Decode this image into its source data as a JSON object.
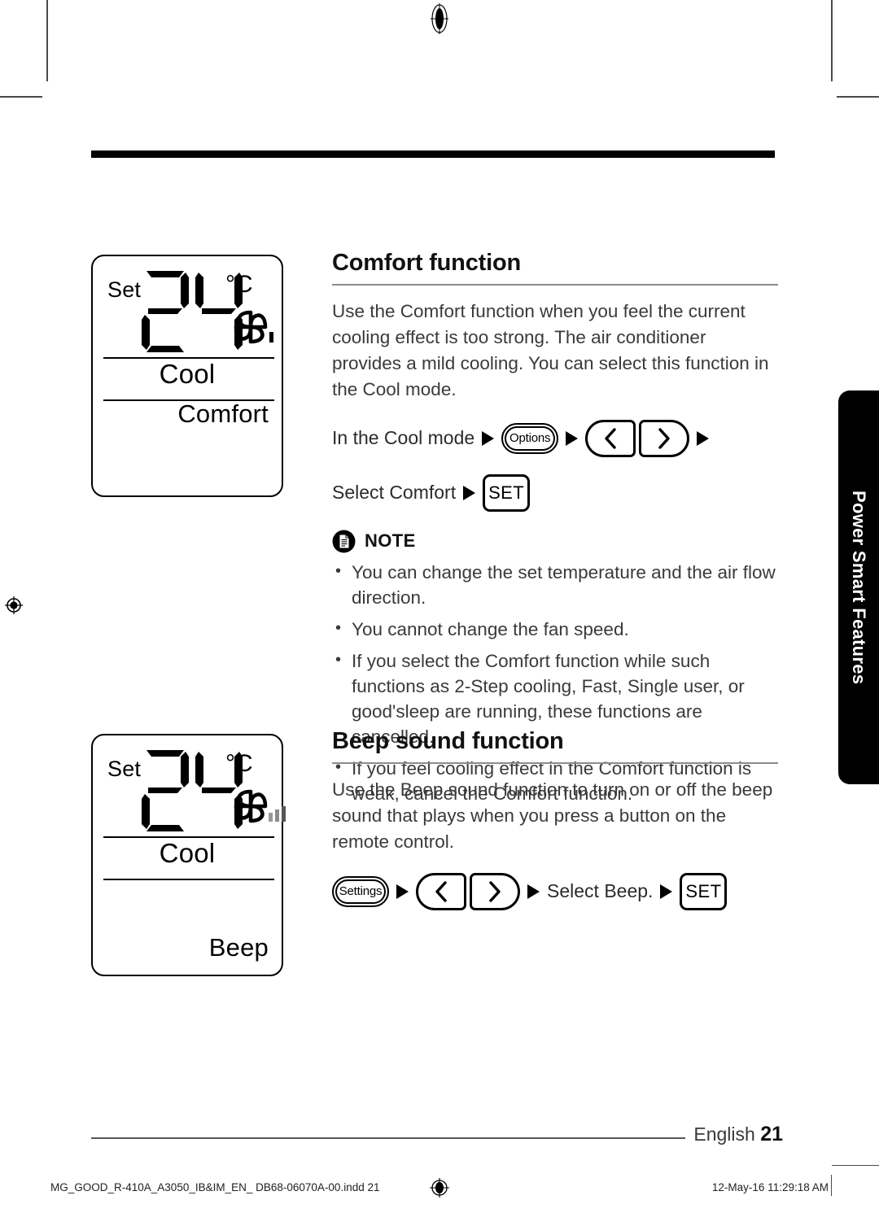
{
  "page": {
    "language_label": "English",
    "page_number": "21",
    "side_tab_label": "Power Smart Features"
  },
  "displays": [
    {
      "set_label": "Set",
      "temperature": "24",
      "unit": "°C",
      "fan_icon": "fan-pinwheel-icon",
      "fan_level": 1,
      "mode": "Cool",
      "feature": "Comfort"
    },
    {
      "set_label": "Set",
      "temperature": "24",
      "unit": "°C",
      "fan_icon": "fan-pinwheel-icon",
      "fan_level": 3,
      "mode": "Cool",
      "feature": "Beep"
    }
  ],
  "sections": [
    {
      "title": "Comfort function",
      "body": "Use the Comfort function when you feel the current cooling effect is too strong. The air conditioner provides a mild cooling. You can select this function in the Cool mode.",
      "steps_line1": {
        "lead_text": "In the Cool mode",
        "options_button": "Options",
        "left_button_icon": "chevron-left-icon",
        "right_button_icon": "chevron-right-icon"
      },
      "steps_line2": {
        "lead_text": "Select Comfort",
        "set_button": "SET"
      }
    },
    {
      "title": "Beep sound function",
      "body": "Use the Beep sound function to turn on or off the beep sound that plays when you press a button on the remote control.",
      "steps_line1": {
        "settings_button": "Settings",
        "left_button_icon": "chevron-left-icon",
        "right_button_icon": "chevron-right-icon",
        "mid_text": "Select Beep.",
        "set_button": "SET"
      }
    }
  ],
  "note": {
    "icon": "note-document-icon",
    "label": "NOTE",
    "items": [
      "You can change the set temperature and the air flow direction.",
      "You cannot change the fan speed.",
      "If you select the Comfort function while such functions as 2-Step cooling, Fast, Single user, or good'sleep are running, these functions are cancelled.",
      "If you feel cooling effect in the Comfort function is weak, cancel the Comfort function."
    ]
  },
  "imprint": {
    "file": "MG_GOOD_R-410A_A3050_IB&IM_EN_ DB68-06070A-00.indd   21",
    "timestamp": "12-May-16   11:29:18 AM"
  },
  "colors": {
    "rule_black": "#000000",
    "divider_gray": "#8c8c8c",
    "text_body": "#3a3a3a",
    "tab_background": "#000000",
    "tab_text": "#ffffff"
  }
}
